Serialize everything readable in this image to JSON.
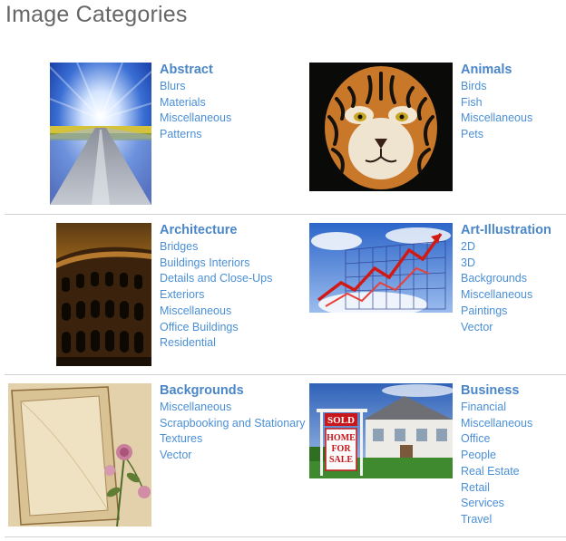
{
  "page": {
    "title": "Image Categories"
  },
  "categories": [
    {
      "title": "Abstract",
      "image_icon": "road-motion-blur-image",
      "links": [
        "Blurs",
        "Materials",
        "Miscellaneous",
        "Patterns"
      ]
    },
    {
      "title": "Animals",
      "image_icon": "tiger-face-image",
      "links": [
        "Birds",
        "Fish",
        "Miscellaneous",
        "Pets"
      ]
    },
    {
      "title": "Architecture",
      "image_icon": "colosseum-image",
      "links": [
        "Bridges",
        "Buildings Interiors",
        "Details and Close-Ups",
        "Exteriors",
        "Miscellaneous",
        "Office Buildings",
        "Residential"
      ]
    },
    {
      "title": "Art-Illustration",
      "image_icon": "arrow-graph-image",
      "links": [
        "2D",
        "3D",
        "Backgrounds",
        "Miscellaneous",
        "Paintings",
        "Vector"
      ]
    },
    {
      "title": "Backgrounds",
      "image_icon": "vintage-paper-roses-image",
      "links": [
        "Miscellaneous",
        "Scrapbooking and Stationary",
        "Textures",
        "Vector"
      ]
    },
    {
      "title": "Business",
      "image_icon": "sold-house-image",
      "links": [
        "Financial",
        "Miscellaneous",
        "Office",
        "People",
        "Real Estate",
        "Retail",
        "Services",
        "Travel"
      ]
    }
  ],
  "sign": {
    "sold": "SOLD",
    "line1": "HOME",
    "line2": "FOR",
    "line3": "SALE"
  }
}
